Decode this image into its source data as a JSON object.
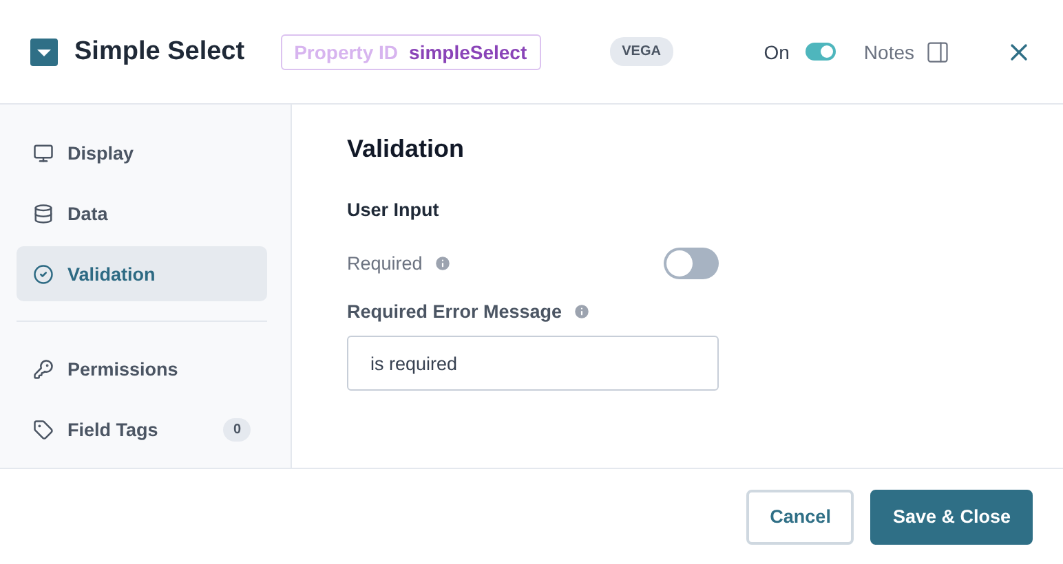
{
  "header": {
    "title": "Simple Select",
    "property_id": {
      "label": "Property ID",
      "value": "simpleSelect"
    },
    "tag": "VEGA",
    "status_toggle": {
      "label": "On",
      "on": true
    },
    "notes": {
      "label": "Notes"
    }
  },
  "sidebar": {
    "groups": [
      {
        "items": [
          {
            "label": "Display",
            "selected": false
          },
          {
            "label": "Data",
            "selected": false
          },
          {
            "label": "Validation",
            "selected": true
          }
        ]
      },
      {
        "items": [
          {
            "label": "Permissions",
            "selected": false
          },
          {
            "label": "Field Tags",
            "selected": false,
            "count": "0"
          }
        ]
      }
    ]
  },
  "content": {
    "title": "Validation",
    "section": "User Input",
    "required": {
      "label": "Required",
      "on": false
    },
    "error_message": {
      "label": "Required Error Message",
      "value": "is required"
    }
  },
  "footer": {
    "buttons": [
      {
        "label": "Cancel",
        "kind": "secondary"
      },
      {
        "label": "Save & Close",
        "kind": "primary"
      }
    ]
  }
}
